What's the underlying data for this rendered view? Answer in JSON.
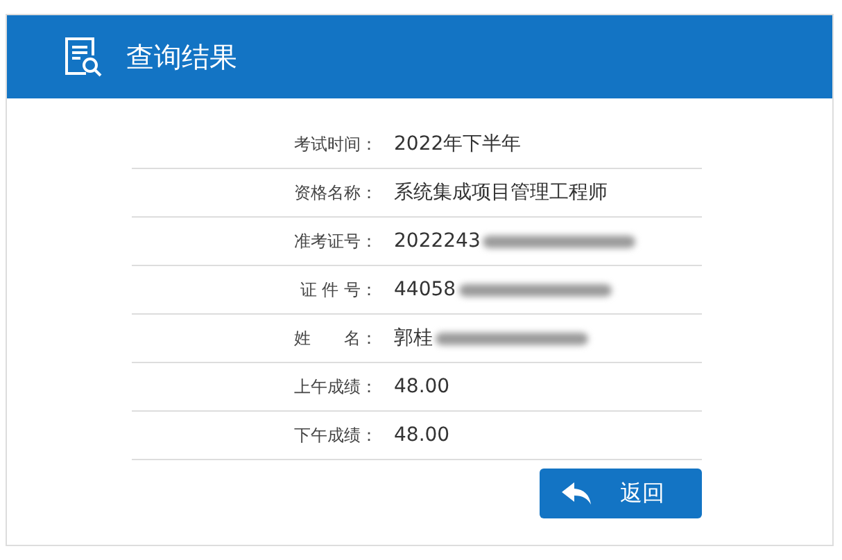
{
  "header": {
    "title": "查询结果"
  },
  "rows": [
    {
      "label": "考试时间：",
      "value": "2022年下半年",
      "redacted": false
    },
    {
      "label": "资格名称：",
      "value": "系统集成项目管理工程师",
      "redacted": false
    },
    {
      "label": "准考证号：",
      "value": "2022243",
      "redacted": true
    },
    {
      "label": "证 件 号：",
      "value": "44058",
      "redacted": true
    },
    {
      "label": "姓　　名：",
      "value": "郭桂",
      "redacted": true
    },
    {
      "label": "上午成绩：",
      "value": "48.00",
      "redacted": false
    },
    {
      "label": "下午成绩：",
      "value": "48.00",
      "redacted": false
    }
  ],
  "button": {
    "label": "返回"
  }
}
